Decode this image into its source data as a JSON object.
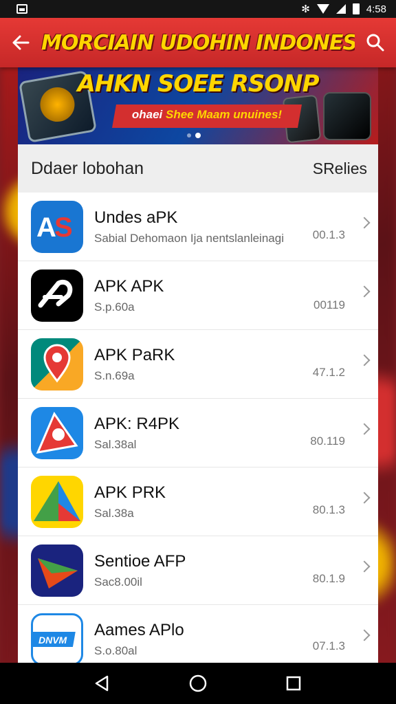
{
  "status_bar": {
    "time": "4:58"
  },
  "app_bar": {
    "title": "MORCIAIN UDOHIN INDONESIA"
  },
  "banner": {
    "title": "AHKN SOEE RSONP",
    "subtitle_prefix": "ohaei ",
    "subtitle_highlight": "Shee Maam unuines!"
  },
  "section": {
    "title": "Ddaer lobohan",
    "action": "SRelies"
  },
  "apps": [
    {
      "name": "Undes aPK",
      "subtitle": "Sabial Dehomaon  Ija nentslanleinagi",
      "version": "00.1.3",
      "icon": "as-logo-icon"
    },
    {
      "name": "APK APK",
      "subtitle": "S.p.60a",
      "version": "00119",
      "icon": "swirl-logo-icon"
    },
    {
      "name": "APK PaRK",
      "subtitle": "S.n.69a",
      "version": "47.1.2",
      "icon": "map-pin-logo-icon"
    },
    {
      "name": "APK: R4PK",
      "subtitle": "Sal.38al",
      "version": "80.119",
      "icon": "flag-logo-icon"
    },
    {
      "name": "APK PRK",
      "subtitle": "Sal.38a",
      "version": "80.1.3",
      "icon": "triangle-logo-icon"
    },
    {
      "name": "Sentioe AFP",
      "subtitle": "Sac8.00il",
      "version": "80.1.9",
      "icon": "paper-plane-logo-icon"
    },
    {
      "name": "Aames APlo",
      "subtitle": "S.o.80al",
      "version": "07.1.3",
      "icon": "dnvvm-logo-icon"
    }
  ]
}
